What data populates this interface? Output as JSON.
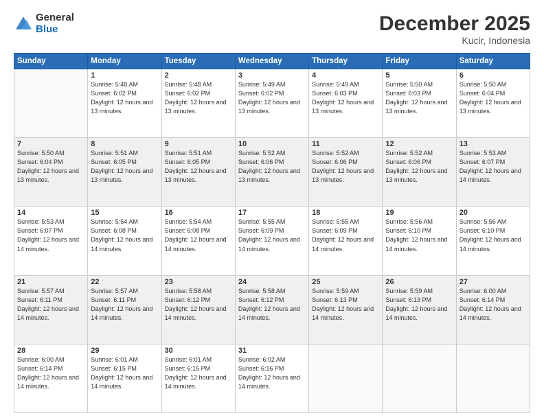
{
  "logo": {
    "general": "General",
    "blue": "Blue"
  },
  "title": "December 2025",
  "location": "Kucir, Indonesia",
  "weekdays": [
    "Sunday",
    "Monday",
    "Tuesday",
    "Wednesday",
    "Thursday",
    "Friday",
    "Saturday"
  ],
  "weeks": [
    [
      {
        "day": null,
        "info": null
      },
      {
        "day": "1",
        "sunrise": "5:48 AM",
        "sunset": "6:02 PM",
        "daylight": "12 hours and 13 minutes."
      },
      {
        "day": "2",
        "sunrise": "5:48 AM",
        "sunset": "6:02 PM",
        "daylight": "12 hours and 13 minutes."
      },
      {
        "day": "3",
        "sunrise": "5:49 AM",
        "sunset": "6:02 PM",
        "daylight": "12 hours and 13 minutes."
      },
      {
        "day": "4",
        "sunrise": "5:49 AM",
        "sunset": "6:03 PM",
        "daylight": "12 hours and 13 minutes."
      },
      {
        "day": "5",
        "sunrise": "5:50 AM",
        "sunset": "6:03 PM",
        "daylight": "12 hours and 13 minutes."
      },
      {
        "day": "6",
        "sunrise": "5:50 AM",
        "sunset": "6:04 PM",
        "daylight": "12 hours and 13 minutes."
      }
    ],
    [
      {
        "day": "7",
        "sunrise": "5:50 AM",
        "sunset": "6:04 PM",
        "daylight": "12 hours and 13 minutes."
      },
      {
        "day": "8",
        "sunrise": "5:51 AM",
        "sunset": "6:05 PM",
        "daylight": "12 hours and 13 minutes."
      },
      {
        "day": "9",
        "sunrise": "5:51 AM",
        "sunset": "6:05 PM",
        "daylight": "12 hours and 13 minutes."
      },
      {
        "day": "10",
        "sunrise": "5:52 AM",
        "sunset": "6:06 PM",
        "daylight": "12 hours and 13 minutes."
      },
      {
        "day": "11",
        "sunrise": "5:52 AM",
        "sunset": "6:06 PM",
        "daylight": "12 hours and 13 minutes."
      },
      {
        "day": "12",
        "sunrise": "5:52 AM",
        "sunset": "6:06 PM",
        "daylight": "12 hours and 13 minutes."
      },
      {
        "day": "13",
        "sunrise": "5:53 AM",
        "sunset": "6:07 PM",
        "daylight": "12 hours and 14 minutes."
      }
    ],
    [
      {
        "day": "14",
        "sunrise": "5:53 AM",
        "sunset": "6:07 PM",
        "daylight": "12 hours and 14 minutes."
      },
      {
        "day": "15",
        "sunrise": "5:54 AM",
        "sunset": "6:08 PM",
        "daylight": "12 hours and 14 minutes."
      },
      {
        "day": "16",
        "sunrise": "5:54 AM",
        "sunset": "6:08 PM",
        "daylight": "12 hours and 14 minutes."
      },
      {
        "day": "17",
        "sunrise": "5:55 AM",
        "sunset": "6:09 PM",
        "daylight": "12 hours and 14 minutes."
      },
      {
        "day": "18",
        "sunrise": "5:55 AM",
        "sunset": "6:09 PM",
        "daylight": "12 hours and 14 minutes."
      },
      {
        "day": "19",
        "sunrise": "5:56 AM",
        "sunset": "6:10 PM",
        "daylight": "12 hours and 14 minutes."
      },
      {
        "day": "20",
        "sunrise": "5:56 AM",
        "sunset": "6:10 PM",
        "daylight": "12 hours and 14 minutes."
      }
    ],
    [
      {
        "day": "21",
        "sunrise": "5:57 AM",
        "sunset": "6:11 PM",
        "daylight": "12 hours and 14 minutes."
      },
      {
        "day": "22",
        "sunrise": "5:57 AM",
        "sunset": "6:11 PM",
        "daylight": "12 hours and 14 minutes."
      },
      {
        "day": "23",
        "sunrise": "5:58 AM",
        "sunset": "6:12 PM",
        "daylight": "12 hours and 14 minutes."
      },
      {
        "day": "24",
        "sunrise": "5:58 AM",
        "sunset": "6:12 PM",
        "daylight": "12 hours and 14 minutes."
      },
      {
        "day": "25",
        "sunrise": "5:59 AM",
        "sunset": "6:13 PM",
        "daylight": "12 hours and 14 minutes."
      },
      {
        "day": "26",
        "sunrise": "5:59 AM",
        "sunset": "6:13 PM",
        "daylight": "12 hours and 14 minutes."
      },
      {
        "day": "27",
        "sunrise": "6:00 AM",
        "sunset": "6:14 PM",
        "daylight": "12 hours and 14 minutes."
      }
    ],
    [
      {
        "day": "28",
        "sunrise": "6:00 AM",
        "sunset": "6:14 PM",
        "daylight": "12 hours and 14 minutes."
      },
      {
        "day": "29",
        "sunrise": "6:01 AM",
        "sunset": "6:15 PM",
        "daylight": "12 hours and 14 minutes."
      },
      {
        "day": "30",
        "sunrise": "6:01 AM",
        "sunset": "6:15 PM",
        "daylight": "12 hours and 14 minutes."
      },
      {
        "day": "31",
        "sunrise": "6:02 AM",
        "sunset": "6:16 PM",
        "daylight": "12 hours and 14 minutes."
      },
      {
        "day": null,
        "info": null
      },
      {
        "day": null,
        "info": null
      },
      {
        "day": null,
        "info": null
      }
    ]
  ],
  "labels": {
    "sunrise": "Sunrise:",
    "sunset": "Sunset:",
    "daylight": "Daylight:"
  }
}
